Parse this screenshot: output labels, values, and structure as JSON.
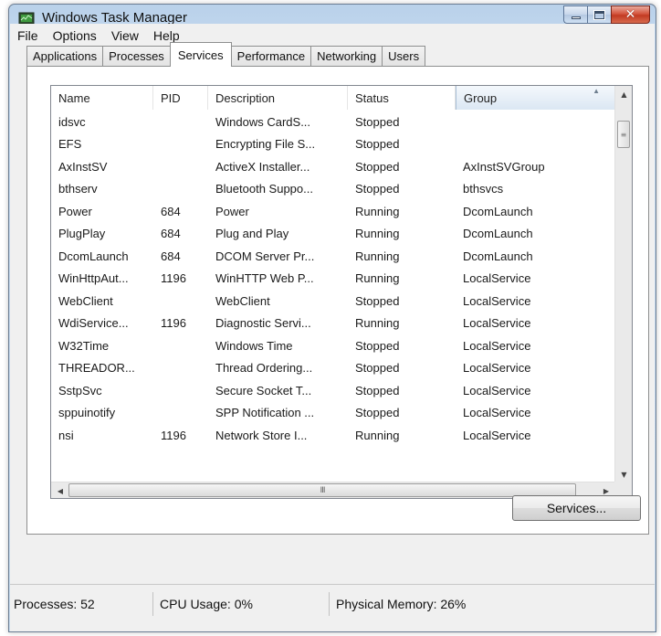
{
  "window": {
    "title": "Windows Task Manager",
    "title_color": "#111111",
    "frame_color": "#c3d8ee",
    "close_color": "#c23a22"
  },
  "caption": {
    "min_icon": "minimize-icon",
    "max_icon": "maximize-icon",
    "close_icon": "close-icon",
    "close_glyph": "✕"
  },
  "menu": [
    "File",
    "Options",
    "View",
    "Help"
  ],
  "tabs": [
    {
      "label": "Applications",
      "active": false
    },
    {
      "label": "Processes",
      "active": false
    },
    {
      "label": "Services",
      "active": true
    },
    {
      "label": "Performance",
      "active": false
    },
    {
      "label": "Networking",
      "active": false
    },
    {
      "label": "Users",
      "active": false
    }
  ],
  "table": {
    "columns": [
      "Name",
      "PID",
      "Description",
      "Status",
      "Group"
    ],
    "sorted_column": "Group",
    "rows": [
      [
        "idsvc",
        "",
        "Windows CardS...",
        "Stopped",
        ""
      ],
      [
        "EFS",
        "",
        "Encrypting File S...",
        "Stopped",
        ""
      ],
      [
        "AxInstSV",
        "",
        "ActiveX Installer...",
        "Stopped",
        "AxInstSVGroup"
      ],
      [
        "bthserv",
        "",
        "Bluetooth Suppo...",
        "Stopped",
        "bthsvcs"
      ],
      [
        "Power",
        "684",
        "Power",
        "Running",
        "DcomLaunch"
      ],
      [
        "PlugPlay",
        "684",
        "Plug and Play",
        "Running",
        "DcomLaunch"
      ],
      [
        "DcomLaunch",
        "684",
        "DCOM Server Pr...",
        "Running",
        "DcomLaunch"
      ],
      [
        "WinHttpAut...",
        "1196",
        "WinHTTP Web P...",
        "Running",
        "LocalService"
      ],
      [
        "WebClient",
        "",
        "WebClient",
        "Stopped",
        "LocalService"
      ],
      [
        "WdiService...",
        "1196",
        "Diagnostic Servi...",
        "Running",
        "LocalService"
      ],
      [
        "W32Time",
        "",
        "Windows Time",
        "Stopped",
        "LocalService"
      ],
      [
        "THREADOR...",
        "",
        "Thread Ordering...",
        "Stopped",
        "LocalService"
      ],
      [
        "SstpSvc",
        "",
        "Secure Socket T...",
        "Stopped",
        "LocalService"
      ],
      [
        "sppuinotify",
        "",
        "SPP Notification ...",
        "Stopped",
        "LocalService"
      ],
      [
        "nsi",
        "1196",
        "Network Store I...",
        "Running",
        "LocalService"
      ]
    ]
  },
  "scroll": {
    "hthumb_grip": "III",
    "vthumb_grip": "≡",
    "vertical_position": 0.08
  },
  "services_button": "Services...",
  "status": {
    "processes": "Processes: 52",
    "cpu": "CPU Usage: 0%",
    "memory": "Physical Memory: 26%"
  }
}
